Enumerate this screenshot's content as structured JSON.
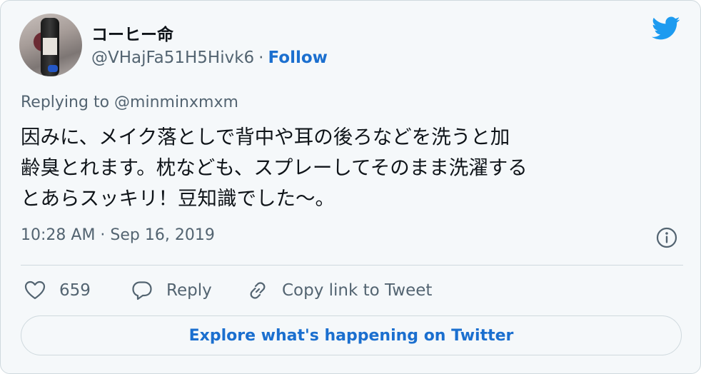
{
  "user": {
    "display_name": "コーヒー命",
    "handle": "@VHajFa51H5Hivk6",
    "separator": "·",
    "follow_label": "Follow"
  },
  "icons": {
    "brand": "twitter-bird-icon",
    "info": "info-icon",
    "like": "heart-icon",
    "reply": "speech-bubble-icon",
    "copy_link": "link-icon"
  },
  "tweet": {
    "reply_to": "Replying to @minminxmxm",
    "lines": [
      "因みに、メイク落としで背中や耳の後ろなどを洗うと加",
      "齢臭とれます。枕なども、スプレーしてそのまま洗濯する",
      "とあらスッキリ！豆知識でした〜。"
    ],
    "timestamp": "10:28 AM · Sep 16, 2019"
  },
  "actions": {
    "like_count": "659",
    "reply_label": "Reply",
    "copy_label": "Copy link to Tweet"
  },
  "explore_label": "Explore what's happening on Twitter",
  "colors": {
    "accent": "#1b6fcf",
    "bird": "#1d9bf0",
    "secondary_text": "#536471",
    "background": "#f5f8fa"
  }
}
